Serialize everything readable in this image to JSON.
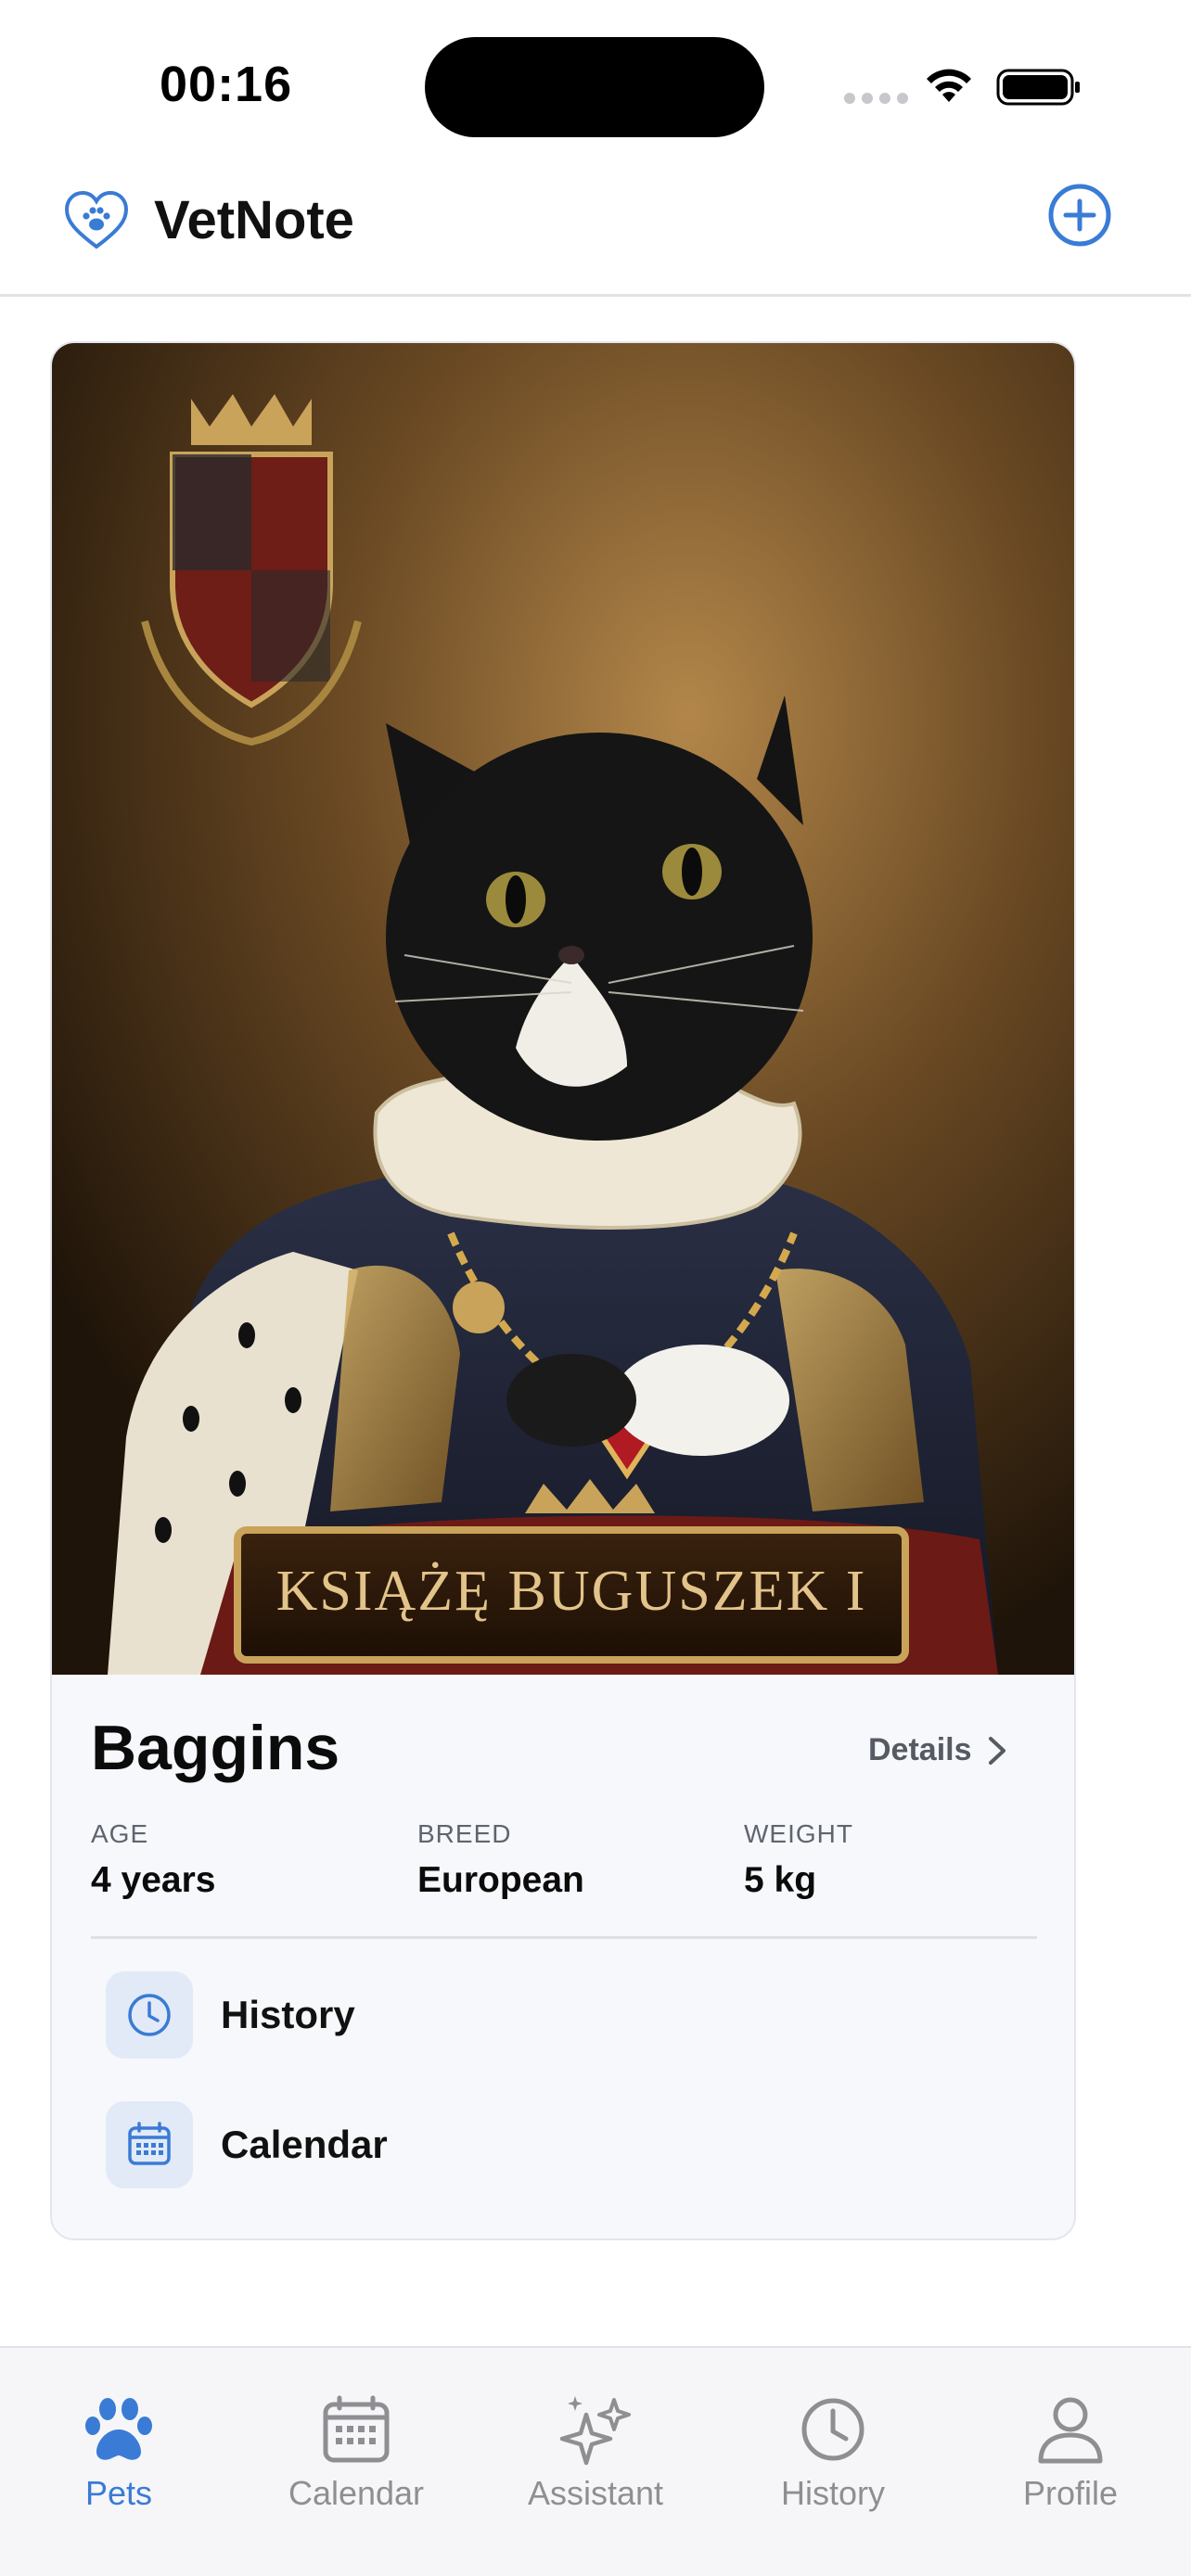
{
  "status_bar": {
    "time": "00:16"
  },
  "header": {
    "title": "VetNote",
    "logo_icon": "heart-paw-icon",
    "add_icon": "plus-circle-icon"
  },
  "colors": {
    "accent": "#3a7bd5",
    "inactive": "#8e8e93",
    "card_bg": "#f6f8fb",
    "icon_tile": "#e2eaf8"
  },
  "pet": {
    "name": "Baggins",
    "details_label": "Details",
    "photo_caption": "KSIĄŻĘ BUGUSZEK I",
    "stats": [
      {
        "label": "AGE",
        "value": "4 years"
      },
      {
        "label": "BREED",
        "value": "European"
      },
      {
        "label": "WEIGHT",
        "value": "5 kg"
      }
    ],
    "actions": [
      {
        "label": "History",
        "icon": "clock-icon"
      },
      {
        "label": "Calendar",
        "icon": "calendar-icon"
      }
    ]
  },
  "tab_bar": {
    "items": [
      {
        "label": "Pets",
        "icon": "paw-icon",
        "active": true
      },
      {
        "label": "Calendar",
        "icon": "calendar-icon",
        "active": false
      },
      {
        "label": "Assistant",
        "icon": "sparkles-icon",
        "active": false
      },
      {
        "label": "History",
        "icon": "clock-icon",
        "active": false
      },
      {
        "label": "Profile",
        "icon": "person-icon",
        "active": false
      }
    ]
  }
}
